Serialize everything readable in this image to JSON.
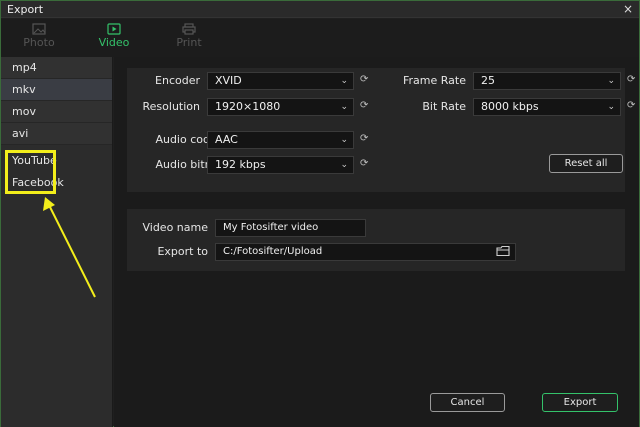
{
  "window": {
    "title": "Export",
    "close_glyph": "×"
  },
  "tabs": [
    {
      "label": "Photo",
      "icon": "photo-icon"
    },
    {
      "label": "Video",
      "icon": "video-icon"
    },
    {
      "label": "Print",
      "icon": "print-icon"
    }
  ],
  "sidebar": {
    "formats": [
      "mp4",
      "mkv",
      "mov",
      "avi"
    ],
    "social": [
      "YouTube",
      "Facebook"
    ]
  },
  "settings": {
    "encoder_label": "Encoder",
    "encoder_value": "XVID",
    "resolution_label": "Resolution",
    "resolution_value": "1920×1080",
    "audio_coding_label": "Audio coding",
    "audio_coding_value": "AAC",
    "audio_bitrate_label": "Audio bitrate",
    "audio_bitrate_value": "192 kbps",
    "frame_rate_label": "Frame Rate",
    "frame_rate_value": "25",
    "bit_rate_label": "Bit Rate",
    "bit_rate_value": "8000 kbps",
    "reset_all_label": "Reset all"
  },
  "output": {
    "video_name_label": "Video name",
    "video_name_value": "My Fotosifter video",
    "export_to_label": "Export to",
    "export_to_value": "C:/Fotosifter/Upload"
  },
  "footer": {
    "cancel_label": "Cancel",
    "export_label": "Export"
  },
  "colors": {
    "accent": "#34c26a",
    "highlight": "#f3ee1b"
  }
}
